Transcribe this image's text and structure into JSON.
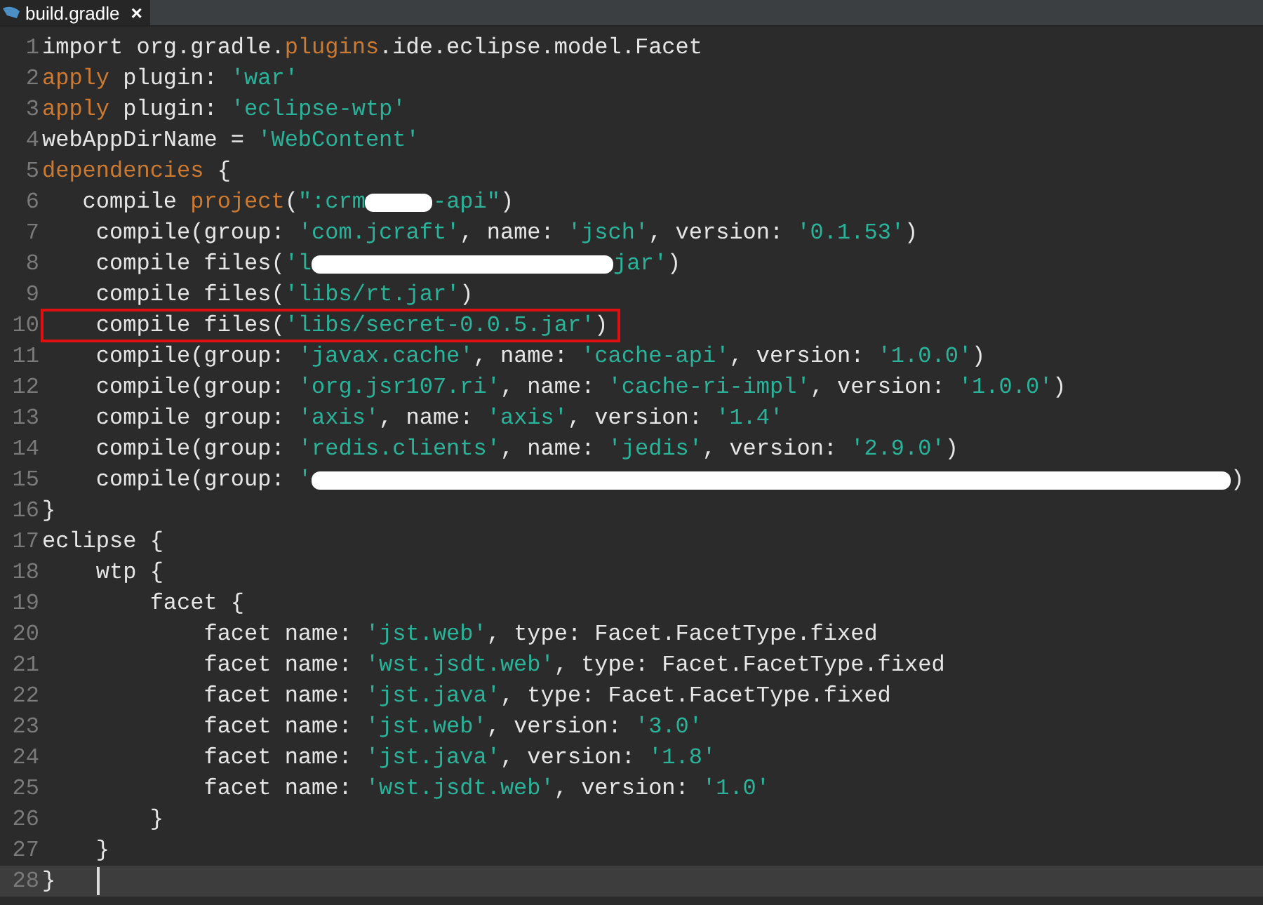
{
  "tab": {
    "title": "build.gradle",
    "close": "×",
    "selected": true
  },
  "lines": [
    {
      "num": "1",
      "boxed": false,
      "current": false,
      "tokens": [
        {
          "kind": "plain",
          "text": "import org.gradle."
        },
        {
          "kind": "kw",
          "text": "plugins"
        },
        {
          "kind": "plain",
          "text": ".ide.eclipse.model.Facet"
        }
      ]
    },
    {
      "num": "2",
      "boxed": false,
      "current": false,
      "tokens": [
        {
          "kind": "kw",
          "text": "apply"
        },
        {
          "kind": "plain",
          "text": " plugin: "
        },
        {
          "kind": "str",
          "text": "'war'"
        }
      ]
    },
    {
      "num": "3",
      "boxed": false,
      "current": false,
      "tokens": [
        {
          "kind": "kw",
          "text": "apply"
        },
        {
          "kind": "plain",
          "text": " plugin: "
        },
        {
          "kind": "str",
          "text": "'eclipse-wtp'"
        }
      ]
    },
    {
      "num": "4",
      "boxed": false,
      "current": false,
      "tokens": [
        {
          "kind": "plain",
          "text": "webAppDirName = "
        },
        {
          "kind": "str",
          "text": "'WebContent'"
        }
      ]
    },
    {
      "num": "5",
      "boxed": false,
      "current": false,
      "tokens": [
        {
          "kind": "kw",
          "text": "dependencies"
        },
        {
          "kind": "plain",
          "text": " {"
        }
      ]
    },
    {
      "num": "6",
      "boxed": false,
      "current": false,
      "tokens": [
        {
          "kind": "plain",
          "text": "   compile "
        },
        {
          "kind": "kw",
          "text": "project"
        },
        {
          "kind": "plain",
          "text": "("
        },
        {
          "kind": "str",
          "text": "\":crm"
        },
        {
          "kind": "blot"
        },
        {
          "kind": "str",
          "text": "-api\""
        },
        {
          "kind": "plain",
          "text": ")"
        }
      ]
    },
    {
      "num": "7",
      "boxed": false,
      "current": false,
      "tokens": [
        {
          "kind": "plain",
          "text": "    compile(group: "
        },
        {
          "kind": "str",
          "text": "'com.jcraft'"
        },
        {
          "kind": "plain",
          "text": ", name: "
        },
        {
          "kind": "str",
          "text": "'jsch'"
        },
        {
          "kind": "plain",
          "text": ", version: "
        },
        {
          "kind": "str",
          "text": "'0.1.53'"
        },
        {
          "kind": "plain",
          "text": ")"
        }
      ]
    },
    {
      "num": "8",
      "boxed": false,
      "current": false,
      "tokens": [
        {
          "kind": "plain",
          "text": "    compile files("
        },
        {
          "kind": "str",
          "text": "'l"
        },
        {
          "kind": "scribble"
        },
        {
          "kind": "str",
          "text": "jar'"
        },
        {
          "kind": "plain",
          "text": ")"
        }
      ]
    },
    {
      "num": "9",
      "boxed": false,
      "current": false,
      "tokens": [
        {
          "kind": "plain",
          "text": "    compile files("
        },
        {
          "kind": "str",
          "text": "'libs/rt.jar'"
        },
        {
          "kind": "plain",
          "text": ")"
        }
      ]
    },
    {
      "num": "10",
      "boxed": true,
      "current": false,
      "tokens": [
        {
          "kind": "plain",
          "text": "    compile files("
        },
        {
          "kind": "str",
          "text": "'libs/secret-0.0.5.jar'"
        },
        {
          "kind": "plain",
          "text": ")"
        }
      ]
    },
    {
      "num": "11",
      "boxed": false,
      "current": false,
      "tokens": [
        {
          "kind": "plain",
          "text": "    compile(group: "
        },
        {
          "kind": "str",
          "text": "'javax.cache'"
        },
        {
          "kind": "plain",
          "text": ", name: "
        },
        {
          "kind": "str",
          "text": "'cache-api'"
        },
        {
          "kind": "plain",
          "text": ", version: "
        },
        {
          "kind": "str",
          "text": "'1.0.0'"
        },
        {
          "kind": "plain",
          "text": ")"
        }
      ]
    },
    {
      "num": "12",
      "boxed": false,
      "current": false,
      "tokens": [
        {
          "kind": "plain",
          "text": "    compile(group: "
        },
        {
          "kind": "str",
          "text": "'org.jsr107.ri'"
        },
        {
          "kind": "plain",
          "text": ", name: "
        },
        {
          "kind": "str",
          "text": "'cache-ri-impl'"
        },
        {
          "kind": "plain",
          "text": ", version: "
        },
        {
          "kind": "str",
          "text": "'1.0.0'"
        },
        {
          "kind": "plain",
          "text": ")"
        }
      ]
    },
    {
      "num": "13",
      "boxed": false,
      "current": false,
      "tokens": [
        {
          "kind": "plain",
          "text": "    compile group: "
        },
        {
          "kind": "str",
          "text": "'axis'"
        },
        {
          "kind": "plain",
          "text": ", name: "
        },
        {
          "kind": "str",
          "text": "'axis'"
        },
        {
          "kind": "plain",
          "text": ", version: "
        },
        {
          "kind": "str",
          "text": "'1.4'"
        }
      ]
    },
    {
      "num": "14",
      "boxed": false,
      "current": false,
      "tokens": [
        {
          "kind": "plain",
          "text": "    compile(group: "
        },
        {
          "kind": "str",
          "text": "'redis.clients'"
        },
        {
          "kind": "plain",
          "text": ", name: "
        },
        {
          "kind": "str",
          "text": "'jedis'"
        },
        {
          "kind": "plain",
          "text": ", version: "
        },
        {
          "kind": "str",
          "text": "'2.9.0'"
        },
        {
          "kind": "plain",
          "text": ")"
        }
      ]
    },
    {
      "num": "15",
      "boxed": false,
      "current": false,
      "tokens": [
        {
          "kind": "plain",
          "text": "    compile(group: "
        },
        {
          "kind": "str",
          "text": "'"
        },
        {
          "kind": "scrawl"
        },
        {
          "kind": "plain",
          "text": ")"
        }
      ]
    },
    {
      "num": "16",
      "boxed": false,
      "current": false,
      "tokens": [
        {
          "kind": "plain",
          "text": "}"
        }
      ]
    },
    {
      "num": "17",
      "boxed": false,
      "current": false,
      "tokens": [
        {
          "kind": "plain",
          "text": "eclipse {"
        }
      ]
    },
    {
      "num": "18",
      "boxed": false,
      "current": false,
      "tokens": [
        {
          "kind": "plain",
          "text": "    wtp {"
        }
      ]
    },
    {
      "num": "19",
      "boxed": false,
      "current": false,
      "tokens": [
        {
          "kind": "plain",
          "text": "        facet {"
        }
      ]
    },
    {
      "num": "20",
      "boxed": false,
      "current": false,
      "tokens": [
        {
          "kind": "plain",
          "text": "            facet name: "
        },
        {
          "kind": "str",
          "text": "'jst.web'"
        },
        {
          "kind": "plain",
          "text": ", type: Facet.FacetType.fixed"
        }
      ]
    },
    {
      "num": "21",
      "boxed": false,
      "current": false,
      "tokens": [
        {
          "kind": "plain",
          "text": "            facet name: "
        },
        {
          "kind": "str",
          "text": "'wst.jsdt.web'"
        },
        {
          "kind": "plain",
          "text": ", type: Facet.FacetType.fixed"
        }
      ]
    },
    {
      "num": "22",
      "boxed": false,
      "current": false,
      "tokens": [
        {
          "kind": "plain",
          "text": "            facet name: "
        },
        {
          "kind": "str",
          "text": "'jst.java'"
        },
        {
          "kind": "plain",
          "text": ", type: Facet.FacetType.fixed"
        }
      ]
    },
    {
      "num": "23",
      "boxed": false,
      "current": false,
      "tokens": [
        {
          "kind": "plain",
          "text": "            facet name: "
        },
        {
          "kind": "str",
          "text": "'jst.web'"
        },
        {
          "kind": "plain",
          "text": ", version: "
        },
        {
          "kind": "str",
          "text": "'3.0'"
        }
      ]
    },
    {
      "num": "24",
      "boxed": false,
      "current": false,
      "tokens": [
        {
          "kind": "plain",
          "text": "            facet name: "
        },
        {
          "kind": "str",
          "text": "'jst.java'"
        },
        {
          "kind": "plain",
          "text": ", version: "
        },
        {
          "kind": "str",
          "text": "'1.8'"
        }
      ]
    },
    {
      "num": "25",
      "boxed": false,
      "current": false,
      "tokens": [
        {
          "kind": "plain",
          "text": "            facet name: "
        },
        {
          "kind": "str",
          "text": "'wst.jsdt.web'"
        },
        {
          "kind": "plain",
          "text": ", version: "
        },
        {
          "kind": "str",
          "text": "'1.0'"
        }
      ]
    },
    {
      "num": "26",
      "boxed": false,
      "current": false,
      "tokens": [
        {
          "kind": "plain",
          "text": "        }"
        }
      ]
    },
    {
      "num": "27",
      "boxed": false,
      "current": false,
      "tokens": [
        {
          "kind": "plain",
          "text": "    }"
        }
      ]
    },
    {
      "num": "28",
      "boxed": false,
      "current": true,
      "tokens": [
        {
          "kind": "plain",
          "text": "}"
        }
      ]
    }
  ]
}
